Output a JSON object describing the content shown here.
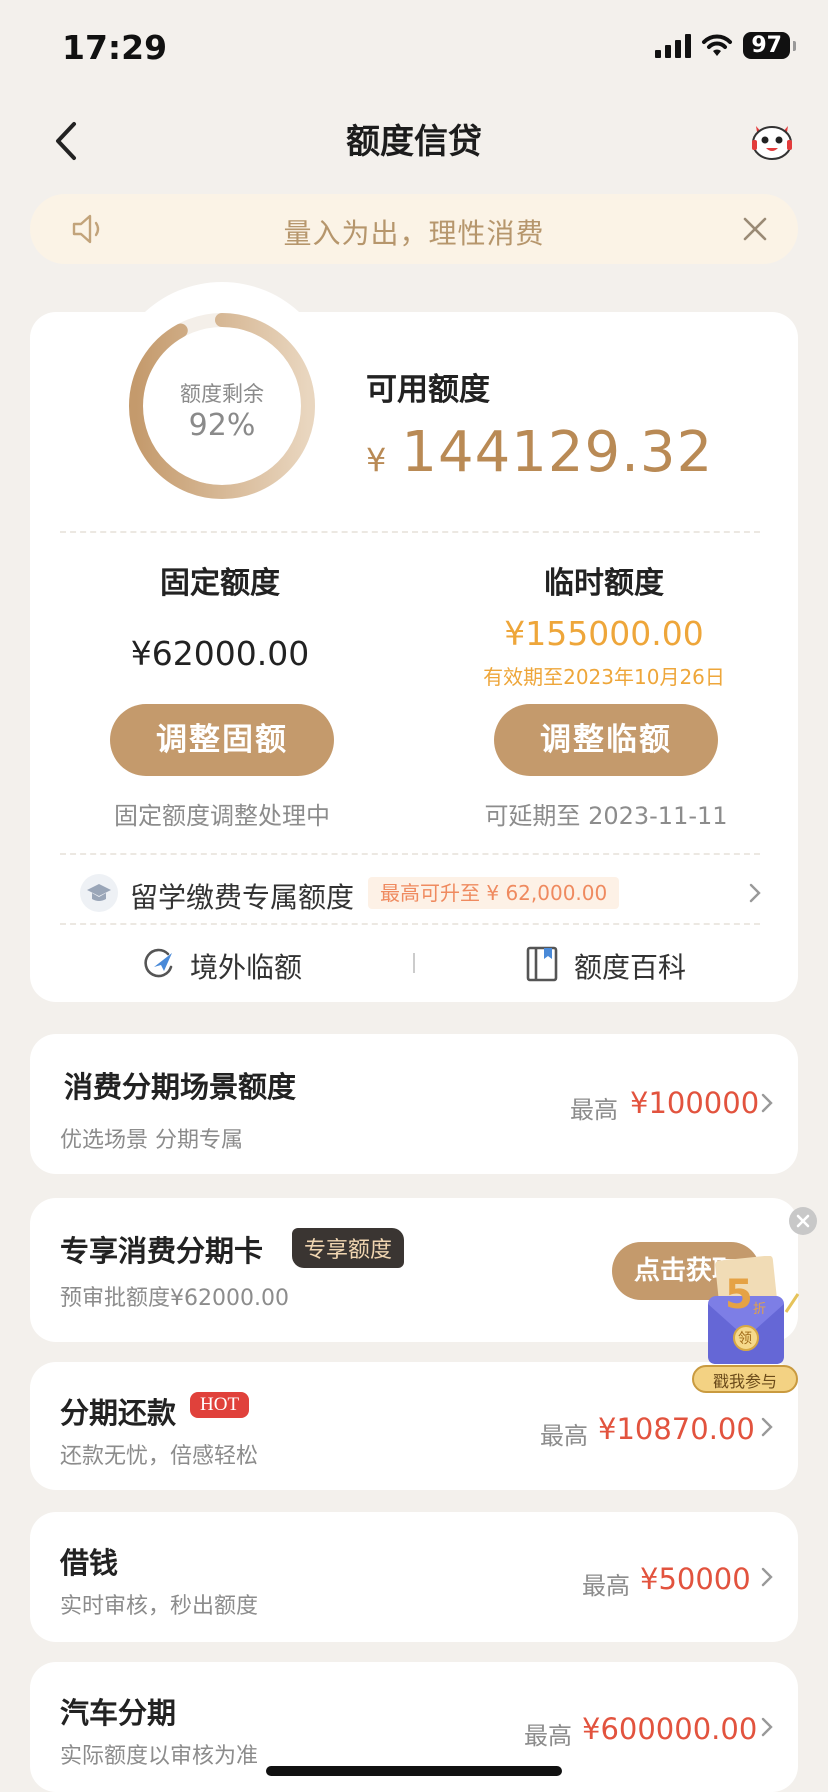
{
  "status": {
    "time": "17:29",
    "battery": "97"
  },
  "nav": {
    "title": "额度信贷"
  },
  "notice": {
    "text": "量入为出，理性消费"
  },
  "summary": {
    "ring_label": "额度剩余",
    "ring_value": "92%",
    "remaining_ratio": 0.92,
    "available_label": "可用额度",
    "currency": "¥",
    "available_amount": "144129.32"
  },
  "fixed": {
    "title": "固定额度",
    "amount": "¥62000.00",
    "button": "调整固额",
    "status": "固定额度调整处理中"
  },
  "temp": {
    "title": "临时额度",
    "amount": "¥155000.00",
    "valid": "有效期至2023年10月26日",
    "button": "调整临额",
    "extend": "可延期至 2023-11-11"
  },
  "study": {
    "label": "留学缴费专属额度",
    "tag": "最高可升至 ¥ 62,000.00"
  },
  "links": {
    "overseas": "境外临额",
    "wiki": "额度百科"
  },
  "rows": {
    "scene": {
      "title": "消费分期场景额度",
      "sub": "优选场景 分期专属",
      "max_label": "最高",
      "max_value": "¥100000"
    },
    "card": {
      "title": "专享消费分期卡",
      "tag": "专享额度",
      "sub": "预审批额度¥62000.00",
      "button": "点击获取"
    },
    "install": {
      "title": "分期还款",
      "hot": "HOT",
      "sub": "还款无忧，倍感轻松",
      "max_label": "最高",
      "max_value": "¥10870.00"
    },
    "borrow": {
      "title": "借钱",
      "sub": "实时审核，秒出额度",
      "max_label": "最高",
      "max_value": "¥50000"
    },
    "car": {
      "title": "汽车分期",
      "sub": "实际额度以审核为准",
      "max_label": "最高",
      "max_value": "¥600000.00"
    }
  },
  "promo": {
    "number": "5",
    "small": "折",
    "badge": "领",
    "caption": "戳我参与"
  }
}
